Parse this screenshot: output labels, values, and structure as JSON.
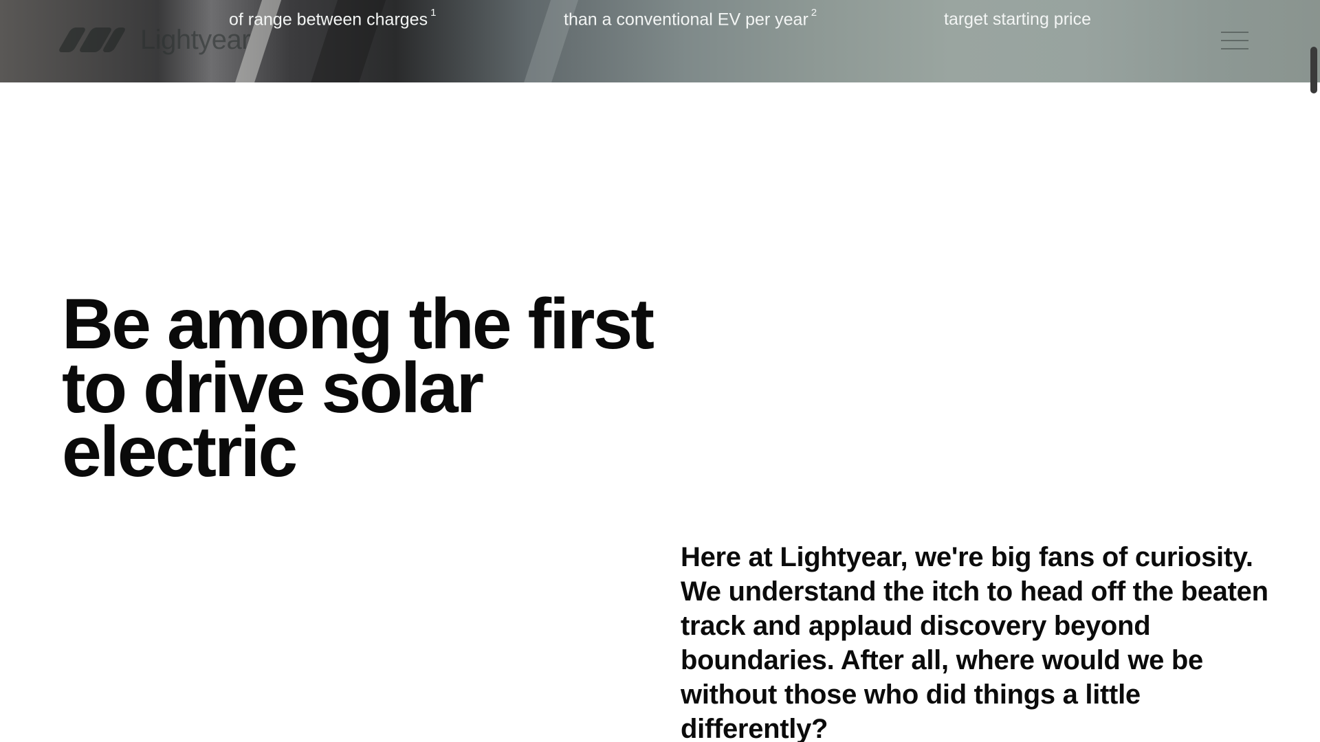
{
  "hero": {
    "stats": [
      {
        "value": "",
        "label": "of range between charges",
        "footnote": "1"
      },
      {
        "value": "",
        "label": "than a conventional EV per year",
        "footnote": "2"
      },
      {
        "value": "",
        "label": "target starting price",
        "footnote": ""
      }
    ]
  },
  "header": {
    "logo_text": "Lightyear",
    "menu_icon": "hamburger-menu-icon"
  },
  "main": {
    "headline": "Be among the first to drive solar electric",
    "intro": "Here at Lightyear, we're big fans of curiosity. We understand the itch to head off the beaten track and applaud discovery beyond boundaries. After all, where would we be without those who did things a little differently?"
  },
  "colors": {
    "background": "#ffffff",
    "text": "#0b0b0b",
    "hero_text": "#f3f5f4"
  }
}
